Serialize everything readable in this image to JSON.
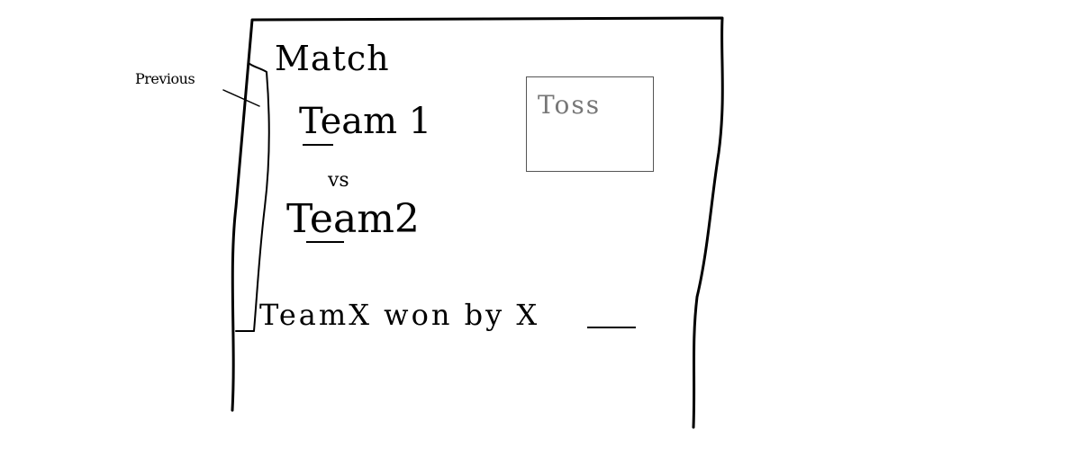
{
  "sidebar": {
    "previous_label": "Previous"
  },
  "match": {
    "title": "Match",
    "team1": "Team 1",
    "vs": "vs",
    "team2": "Team2",
    "result": "TeamX won by X"
  },
  "toss": {
    "label": "Toss"
  }
}
